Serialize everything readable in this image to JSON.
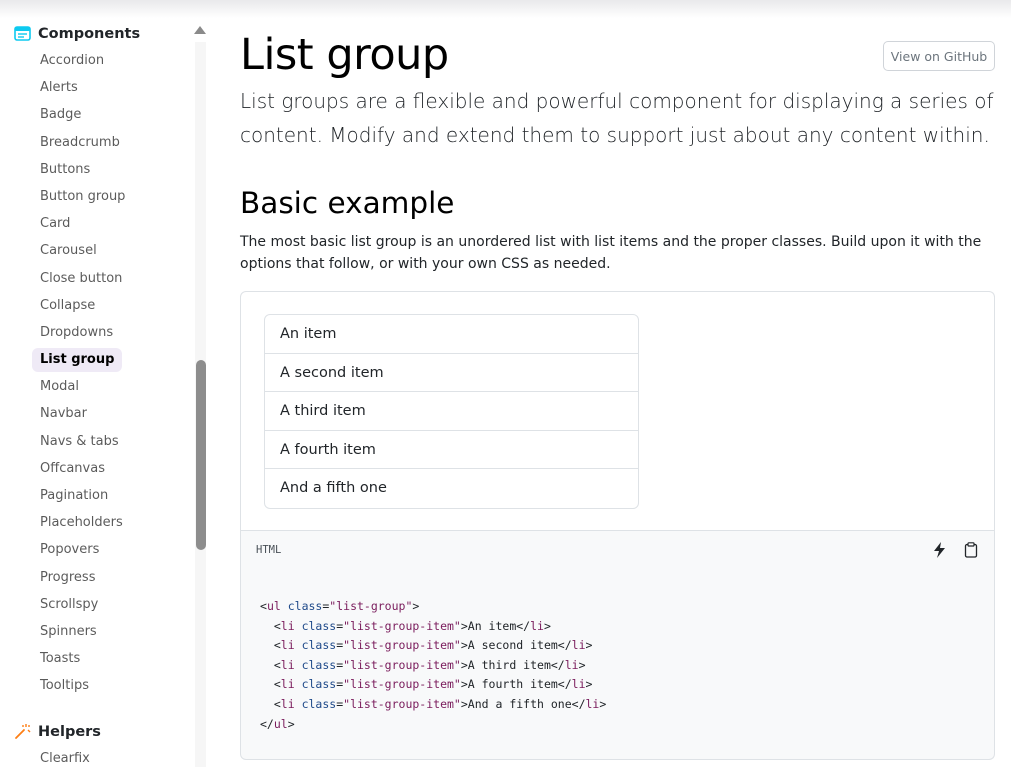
{
  "sidebar": {
    "components_label": "Components",
    "items": [
      {
        "label": "Accordion",
        "active": false
      },
      {
        "label": "Alerts",
        "active": false
      },
      {
        "label": "Badge",
        "active": false
      },
      {
        "label": "Breadcrumb",
        "active": false
      },
      {
        "label": "Buttons",
        "active": false
      },
      {
        "label": "Button group",
        "active": false
      },
      {
        "label": "Card",
        "active": false
      },
      {
        "label": "Carousel",
        "active": false
      },
      {
        "label": "Close button",
        "active": false
      },
      {
        "label": "Collapse",
        "active": false
      },
      {
        "label": "Dropdowns",
        "active": false
      },
      {
        "label": "List group",
        "active": true
      },
      {
        "label": "Modal",
        "active": false
      },
      {
        "label": "Navbar",
        "active": false
      },
      {
        "label": "Navs & tabs",
        "active": false
      },
      {
        "label": "Offcanvas",
        "active": false
      },
      {
        "label": "Pagination",
        "active": false
      },
      {
        "label": "Placeholders",
        "active": false
      },
      {
        "label": "Popovers",
        "active": false
      },
      {
        "label": "Progress",
        "active": false
      },
      {
        "label": "Scrollspy",
        "active": false
      },
      {
        "label": "Spinners",
        "active": false
      },
      {
        "label": "Toasts",
        "active": false
      },
      {
        "label": "Tooltips",
        "active": false
      }
    ],
    "helpers_label": "Helpers",
    "helpers_items": [
      {
        "label": "Clearfix"
      }
    ],
    "components_icon": "window-stack-icon",
    "helpers_icon": "magic-wand-icon"
  },
  "main": {
    "title": "List group",
    "github_label": "View on GitHub",
    "lead": "List groups are a flexible and powerful component for displaying a series of content. Modify and extend them to support just about any content within.",
    "section_title": "Basic example",
    "section_desc": "The most basic list group is an unordered list with list items and the proper classes. Build upon it with the options that follow, or with your own CSS as needed.",
    "list_items": [
      "An item",
      "A second item",
      "A third item",
      "A fourth item",
      "And a fifth one"
    ],
    "code_lang": "HTML",
    "code_icons": [
      "lightning-icon",
      "clipboard-icon"
    ],
    "code": {
      "ul_open_tag": "ul",
      "ul_class_attr": "class",
      "ul_class_value": "\"list-group\"",
      "li_tag": "li",
      "li_class_attr": "class",
      "li_class_value": "\"list-group-item\"",
      "ul_close_tag": "ul"
    }
  },
  "colors": {
    "accent_purple": "#7952b3",
    "components_icon": "#0dcaf0",
    "helpers_icon": "#fd7e14"
  }
}
